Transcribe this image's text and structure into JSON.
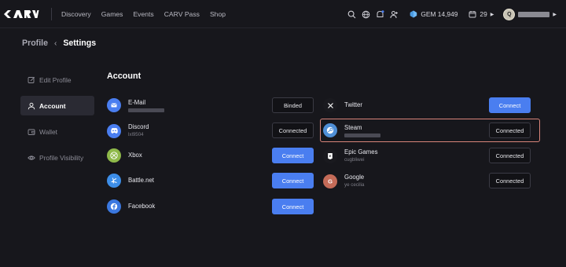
{
  "nav": {
    "items": [
      {
        "label": "Discovery"
      },
      {
        "label": "Games"
      },
      {
        "label": "Events"
      },
      {
        "label": "CARV Pass"
      },
      {
        "label": "Shop"
      }
    ]
  },
  "header": {
    "gem_label": "GEM 14,949",
    "calendar_count": "29"
  },
  "breadcrumb": {
    "parent": "Profile",
    "current": "Settings"
  },
  "sidebar": {
    "items": [
      {
        "label": "Edit Profile"
      },
      {
        "label": "Account"
      },
      {
        "label": "Wallet"
      },
      {
        "label": "Profile Visibility"
      }
    ]
  },
  "account": {
    "title": "Account",
    "left": [
      {
        "name": "E-Mail",
        "sub": "",
        "button": "Binded",
        "icon": "mail-icon"
      },
      {
        "name": "Discord",
        "sub": "lxl9504",
        "button": "Connected",
        "icon": "discord-icon"
      },
      {
        "name": "Xbox",
        "sub": "",
        "button": "Connect",
        "icon": "xbox-icon"
      },
      {
        "name": "Battle.net",
        "sub": "",
        "button": "Connect",
        "icon": "battlenet-icon"
      },
      {
        "name": "Facebook",
        "sub": "",
        "button": "Connect",
        "icon": "facebook-icon"
      }
    ],
    "right": [
      {
        "name": "Twitter",
        "sub": "",
        "button": "Connect",
        "icon": "x-icon"
      },
      {
        "name": "Steam",
        "sub": "",
        "button": "Connected",
        "icon": "steam-icon"
      },
      {
        "name": "Epic Games",
        "sub": "cugbliwei",
        "button": "Connected",
        "icon": "epic-games-icon"
      },
      {
        "name": "Google",
        "sub": "ye cecilia",
        "button": "Connected",
        "icon": "google-icon"
      }
    ]
  },
  "colors": {
    "background": "#17171c",
    "accent_blue": "#4a7ef0",
    "highlight": "#d9857a"
  }
}
